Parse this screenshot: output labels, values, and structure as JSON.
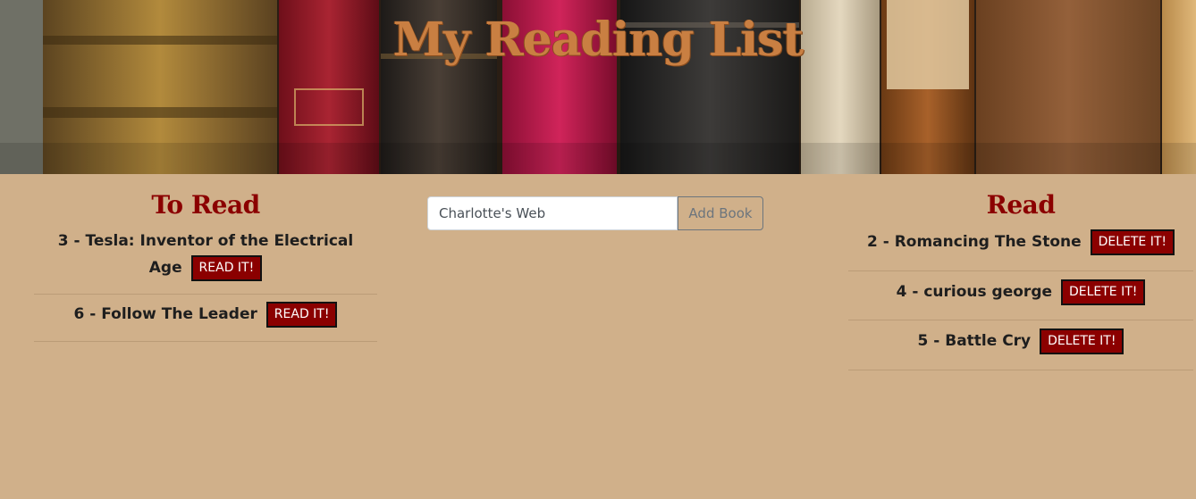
{
  "header": {
    "title": "My Reading List"
  },
  "to_read": {
    "heading": "To Read",
    "button_label": "READ IT!",
    "items": [
      {
        "text": "3 - Tesla: Inventor of the Electrical Age"
      },
      {
        "text": "6 - Follow The Leader"
      }
    ]
  },
  "add_book": {
    "input_value": "Charlotte's Web",
    "button_label": "Add Book"
  },
  "read": {
    "heading": "Read",
    "button_label": "DELETE IT!",
    "items": [
      {
        "text": "2 - Romancing The Stone"
      },
      {
        "text": "4 - curious george"
      },
      {
        "text": "5 - Battle Cry"
      }
    ]
  },
  "colors": {
    "background": "#d0b08a",
    "accent": "#8b0000",
    "title": "#c97f42"
  }
}
